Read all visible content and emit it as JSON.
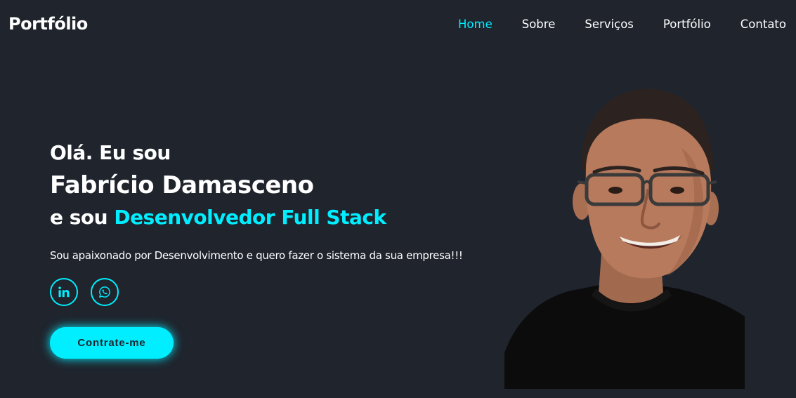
{
  "header": {
    "logo": "Portfólio",
    "nav": [
      {
        "label": "Home",
        "active": true
      },
      {
        "label": "Sobre",
        "active": false
      },
      {
        "label": "Serviços",
        "active": false
      },
      {
        "label": "Portfólio",
        "active": false
      },
      {
        "label": "Contato",
        "active": false
      }
    ]
  },
  "hero": {
    "greeting": "Olá. Eu sou",
    "name": "Fabrício Damasceno",
    "role_prefix": "e sou ",
    "role": "Desenvolvedor Full Stack",
    "description": "Sou apaixonado por Desenvolvimento e quero fazer o sistema da sua empresa!!!",
    "socials": [
      {
        "icon": "linkedin-icon"
      },
      {
        "icon": "whatsapp-icon"
      }
    ],
    "cta_label": "Contrate-me"
  },
  "colors": {
    "background": "#1f242d",
    "accent": "#00eeff",
    "text": "#ffffff"
  }
}
